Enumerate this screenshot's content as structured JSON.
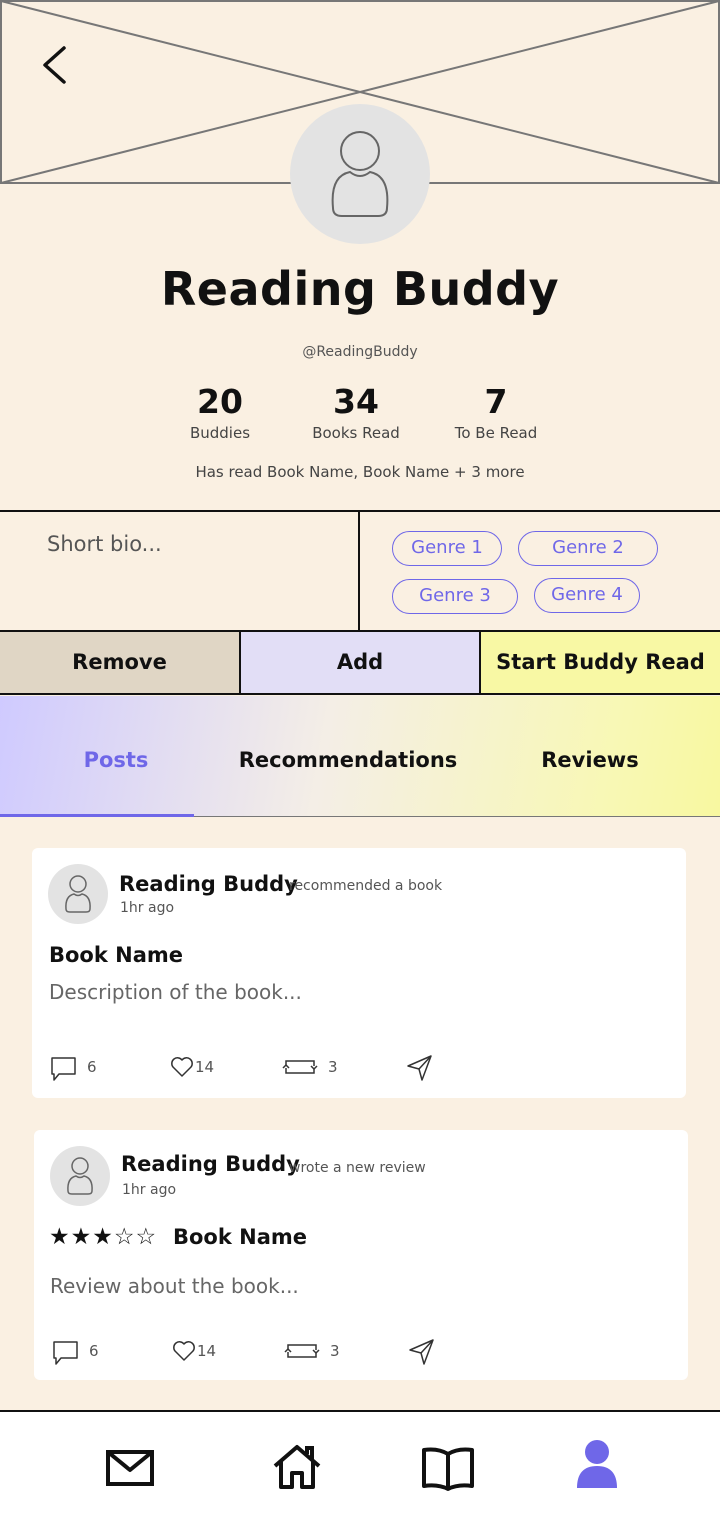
{
  "profile": {
    "name": "Reading Buddy",
    "handle": "@ReadingBuddy",
    "stats": [
      {
        "value": "20",
        "label": "Buddies"
      },
      {
        "value": "34",
        "label": "Books Read"
      },
      {
        "value": "7",
        "label": "To Be Read"
      }
    ],
    "has_read": "Has read Book Name, Book Name + 3 more",
    "bio": "Short bio...",
    "genres": [
      "Genre 1",
      "Genre 2",
      "Genre 3",
      "Genre 4"
    ]
  },
  "actions": {
    "remove": "Remove",
    "add": "Add",
    "start_buddy_read": "Start Buddy Read"
  },
  "tabs": [
    "Posts",
    "Recommendations",
    "Reviews"
  ],
  "active_tab": "Posts",
  "posts": [
    {
      "author": "Reading Buddy",
      "action": "recommended a book",
      "time": "1hr ago",
      "title": "Book Name",
      "body": "Description of the book...",
      "comments": "6",
      "likes": "14",
      "reposts": "3"
    },
    {
      "author": "Reading Buddy",
      "action": "wrote a new review",
      "time": "1hr ago",
      "rating": 3,
      "rating_max": 5,
      "stars_text": "★★★☆☆",
      "title": "Book Name",
      "body": "Review about the book...",
      "comments": "6",
      "likes": "14",
      "reposts": "3"
    }
  ],
  "nav": {
    "items": [
      "mail-icon",
      "home-icon",
      "book-icon",
      "profile-icon"
    ],
    "active": "profile-icon",
    "active_color": "#6f67e8"
  },
  "colors": {
    "background": "#faf0e2",
    "accent": "#6f67e8",
    "remove_bg": "#e0d6c5",
    "add_bg": "#e2def6",
    "buddy_read_bg": "#f8f8a4"
  }
}
